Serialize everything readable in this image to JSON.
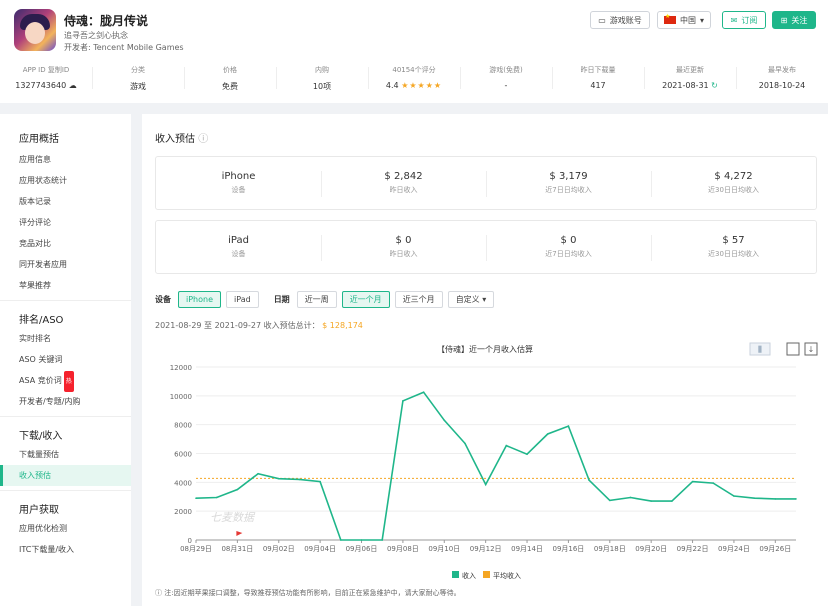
{
  "app": {
    "title": "侍魂：胧月传说",
    "subtitle": "追寻吾之剑心执念",
    "developer": "开发者: Tencent Mobile Games"
  },
  "header_buttons": {
    "game_account": "游戏账号",
    "region": "中国",
    "subscribe": "订阅",
    "follow": "关注"
  },
  "stats": [
    {
      "label": "APP ID  复制ID",
      "value": "1327743640"
    },
    {
      "label": "分类",
      "value": "游戏"
    },
    {
      "label": "价格",
      "value": "免费"
    },
    {
      "label": "内购",
      "value": "10项"
    },
    {
      "label": "40154个评分",
      "value": "4.4"
    },
    {
      "label": "游戏(免费)",
      "value": "-"
    },
    {
      "label": "昨日下载量",
      "value": "417"
    },
    {
      "label": "最近更新",
      "value": "2021-08-31"
    },
    {
      "label": "最早发布",
      "value": "2018-10-24"
    }
  ],
  "rating_stars": "★★★★★",
  "sidebar": {
    "sec1": "应用概括",
    "items1": [
      "应用信息",
      "应用状态统计",
      "版本记录",
      "评分评论",
      "竞品对比",
      "同开发者应用",
      "苹果推荐"
    ],
    "sec2": "排名/ASO",
    "items2": [
      "实时排名",
      "ASO 关键词",
      "ASA 竞价词",
      "开发者/专题/内购"
    ],
    "hot": "热",
    "sec3": "下载/收入",
    "items3": [
      "下载量预估",
      "收入预估"
    ],
    "sec4": "用户获取",
    "items4": [
      "应用优化检测",
      "ITC下载量/收入"
    ]
  },
  "main": {
    "title": "收入预估",
    "iphone_card": {
      "device": "iPhone",
      "device_label": "设备",
      "c1": "$ 2,842",
      "c1l": "昨日收入",
      "c2": "$ 3,179",
      "c2l": "近7日日均收入",
      "c3": "$ 4,272",
      "c3l": "近30日日均收入"
    },
    "ipad_card": {
      "device": "iPad",
      "device_label": "设备",
      "c1": "$ 0",
      "c1l": "昨日收入",
      "c2": "$ 0",
      "c2l": "近7日日均收入",
      "c3": "$ 57",
      "c3l": "近30日日均收入"
    },
    "filters": {
      "device_label": "设备",
      "iphone": "iPhone",
      "ipad": "iPad",
      "date_label": "日期",
      "week": "近一周",
      "month": "近一个月",
      "quarter": "近三个月",
      "custom": "自定义"
    },
    "summary_text": "2021-08-29 至 2021-09-27 收入预估总计：",
    "summary_amount": "$ 128,174",
    "note": "注:因近期苹果接口调整，导致推荐预估功能有所影响，目前正在紧急维护中，请大家耐心等待。"
  },
  "chart_data": {
    "type": "line",
    "title": "【侍魂】近一个月收入估算",
    "x": [
      "08月29日",
      "08月30日",
      "08月31日",
      "09月01日",
      "09月02日",
      "09月03日",
      "09月04日",
      "09月05日",
      "09月06日",
      "09月07日",
      "09月08日",
      "09月09日",
      "09月10日",
      "09月11日",
      "09月12日",
      "09月13日",
      "09月14日",
      "09月15日",
      "09月16日",
      "09月17日",
      "09月18日",
      "09月19日",
      "09月20日",
      "09月21日",
      "09月22日",
      "09月23日",
      "09月24日",
      "09月25日",
      "09月26日",
      "09月27日"
    ],
    "xticks": [
      "08月29日",
      "08月31日",
      "09月02日",
      "09月04日",
      "09月06日",
      "09月08日",
      "09月10日",
      "09月12日",
      "09月14日",
      "09月16日",
      "09月18日",
      "09月20日",
      "09月22日",
      "09月24日",
      "09月26日"
    ],
    "series": [
      {
        "name": "收入",
        "color": "#1fb68a",
        "values": [
          2900,
          2950,
          3500,
          4600,
          4250,
          4200,
          4050,
          0,
          0,
          0,
          9650,
          10250,
          8300,
          6700,
          3850,
          6550,
          5950,
          7350,
          7900,
          4150,
          2750,
          2950,
          2700,
          2700,
          4050,
          3950,
          3050,
          2900,
          2850,
          2850
        ]
      },
      {
        "name": "平均收入",
        "color": "#f5a623",
        "values": [
          4272
        ]
      }
    ],
    "ylim": [
      0,
      12000
    ],
    "yticks": [
      0,
      2000,
      4000,
      6000,
      8000,
      10000,
      12000
    ],
    "watermark": "七麦数据",
    "legend_position": "bottom"
  }
}
